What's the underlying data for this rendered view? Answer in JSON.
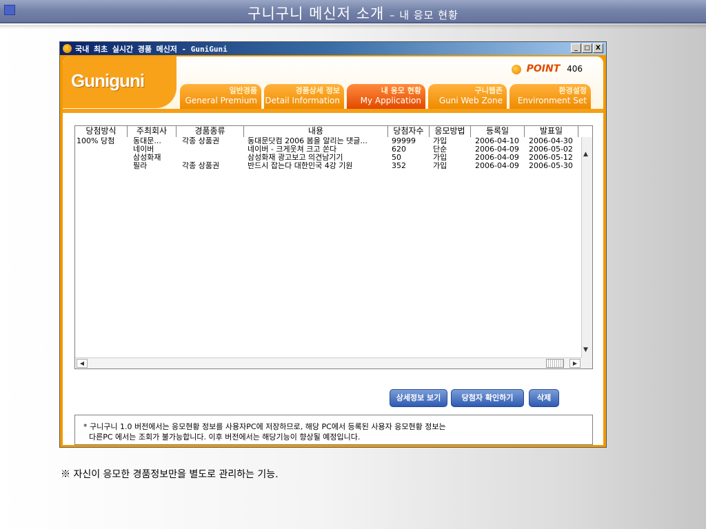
{
  "slide": {
    "title": "구니구니 메신저 소개",
    "subtitle": "– 내 응모 현황"
  },
  "window": {
    "title": "국내 최초 실시간 경품 메신저 - GuniGuni",
    "buttons": {
      "minimize": "_",
      "maximize": "□",
      "close": "X"
    }
  },
  "app": {
    "logo": "Guniguni",
    "point_label": "POINT",
    "point_value": "406",
    "tabs": [
      {
        "ko": "일반경품",
        "en": "General Premium"
      },
      {
        "ko": "경품상세 정보",
        "en": "Detail Information"
      },
      {
        "ko": "내 응모 현황",
        "en": "My Application"
      },
      {
        "ko": "구니웹존",
        "en": "Guni Web Zone"
      },
      {
        "ko": "환경설정",
        "en": "Environment Set"
      }
    ],
    "active_tab": 2
  },
  "table": {
    "columns": [
      "당첨방식",
      "주최회사",
      "경품종류",
      "내용",
      "당첨자수",
      "응모방법",
      "등록일",
      "발표일"
    ],
    "rows": [
      [
        "100% 당첨",
        "동대문...",
        "각종 상품권",
        "동대문닷컴 2006 봄을 알리는 댓글...",
        "99999",
        "가입",
        "2006-04-10",
        "2006-04-30"
      ],
      [
        "",
        "네이버",
        "",
        "네이버 - 크게웃쳐 크고 쏜다",
        "620",
        "단순",
        "2006-04-09",
        "2006-05-02"
      ],
      [
        "",
        "삼성화재",
        "",
        "삼성화재 광고보고 의견남기기",
        "50",
        "가입",
        "2006-04-09",
        "2006-05-12"
      ],
      [
        "",
        "필라",
        "각종 상품권",
        "반드시 잡는다 대한민국 4강 기원",
        "352",
        "가입",
        "2006-04-09",
        "2006-05-30"
      ]
    ]
  },
  "actions": {
    "detail": "상세정보 보기",
    "winner": "당첨자 확인하기",
    "delete": "삭제"
  },
  "notice": {
    "line1": "* 구니구니 1.0 버전에서는 응모현황 정보를 사용자PC에 저장하므로, 해당 PC에서 등록된 사용자 응모현황 정보는",
    "line2": "다른PC 에서는 조회가 불가능합니다. 이후 버전에서는 해당기능이 향상될 예정입니다."
  },
  "footnote": "※ 자신이 응모한 경품정보만을 별도로 관리하는 기능.",
  "colors": {
    "window_frame": "#f29a00",
    "tab_orange": "#f08b00",
    "tab_active": "#e24a00",
    "button_blue": "#2f5ab0",
    "slide_bar": "#7584ab"
  }
}
